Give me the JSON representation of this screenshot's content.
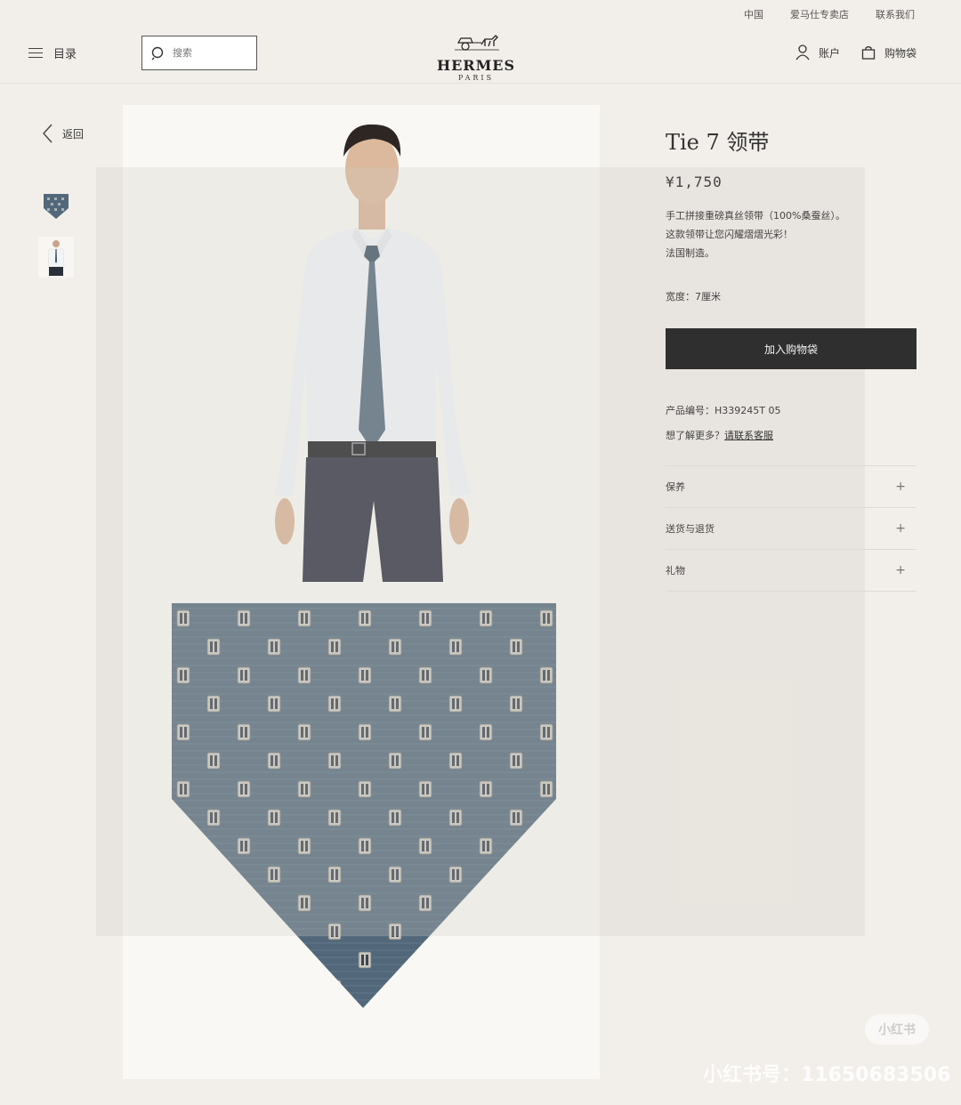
{
  "util_bar": {
    "region": "中国",
    "stores": "爱马仕专卖店",
    "contact": "联系我们"
  },
  "header": {
    "menu_label": "目录",
    "search_placeholder": "搜索",
    "logo_brand": "HERMES",
    "logo_city": "PARIS",
    "account_label": "账户",
    "bag_label": "购物袋"
  },
  "nav": {
    "back_label": "返回"
  },
  "product": {
    "title": "Tie 7 领带",
    "price": "¥1,750",
    "desc_line1": "手工拼接重磅真丝领带（100%桑蚕丝）。",
    "desc_line2": "这款领带让您闪耀熠熠光彩！",
    "desc_line3": "法国制造。",
    "width": "宽度：7厘米",
    "add_to_bag": "加入购物袋",
    "sku": "产品编号：H339245T 05",
    "help_prefix": "想了解更多？",
    "help_link": "请联系客服"
  },
  "accordion": [
    {
      "label": "保养",
      "icon": "plus-icon"
    },
    {
      "label": "送货与退货",
      "icon": "plus-icon"
    },
    {
      "label": "礼物",
      "icon": "plus-icon"
    }
  ],
  "watermark": {
    "badge": "小红书",
    "id_text": "小红书号：11650683506"
  },
  "colors": {
    "background": "#f2eee9",
    "button": "#2f2f2f",
    "tie_blue": "#52687a",
    "tie_dark": "#3e5262"
  }
}
